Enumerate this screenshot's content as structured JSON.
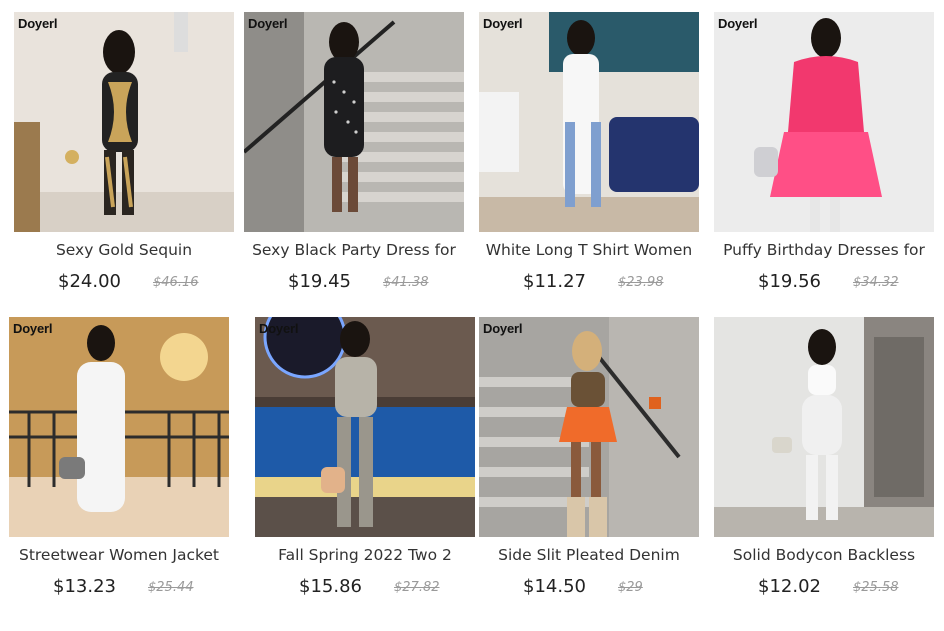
{
  "products": [
    {
      "brand": "Doyerl",
      "title": "Sexy Gold Sequin",
      "price": "$24.00",
      "old_price": "$46.16"
    },
    {
      "brand": "Doyerl",
      "title": "Sexy Black Party Dress for",
      "price": "$19.45",
      "old_price": "$41.38"
    },
    {
      "brand": "Doyerl",
      "title": "White Long T Shirt Women",
      "price": "$11.27",
      "old_price": "$23.98"
    },
    {
      "brand": "Doyerl",
      "title": "Puffy Birthday Dresses for",
      "price": "$19.56",
      "old_price": "$34.32"
    },
    {
      "brand": "Doyerl",
      "title": "Streetwear Women Jacket",
      "price": "$13.23",
      "old_price": "$25.44"
    },
    {
      "brand": "Doyerl",
      "title": "Fall Spring 2022 Two 2",
      "price": "$15.86",
      "old_price": "$27.82"
    },
    {
      "brand": "Doyerl",
      "title": "Side Slit Pleated Denim",
      "price": "$14.50",
      "old_price": "$29"
    },
    {
      "brand": "",
      "title": "Solid Bodycon Backless",
      "price": "$12.02",
      "old_price": "$25.58"
    }
  ],
  "colors": {
    "price": "#222222",
    "old_price": "#9a9a9a",
    "title": "#333333"
  }
}
